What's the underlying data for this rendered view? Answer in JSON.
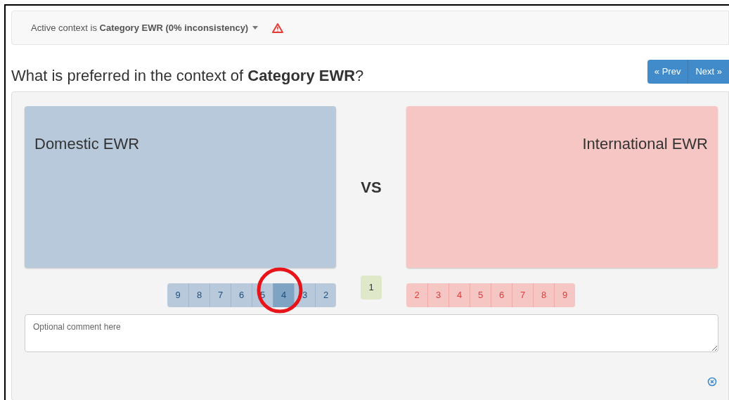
{
  "context_bar": {
    "text": "Active context is **Category EWR (0% inconsistency)**",
    "warning": true
  },
  "question": "What is preferred in the context of **Category EWR**?",
  "pager": [
    "« Prev",
    "Next »"
  ],
  "left_option": {
    "label": "Domestic EWR"
  },
  "separator": "VS",
  "right_option": {
    "label": "International EWR"
  },
  "left_scale": [
    {
      "label": "9",
      "selected": false
    },
    {
      "label": "8",
      "selected": false
    },
    {
      "label": "7",
      "selected": false
    },
    {
      "label": "6",
      "selected": false
    },
    {
      "label": "5",
      "selected": false
    },
    {
      "label": "4",
      "selected": true
    },
    {
      "label": "3",
      "selected": false
    },
    {
      "label": "2",
      "selected": false
    }
  ],
  "equal": {
    "label": "1",
    "selected": false
  },
  "right_scale": [
    {
      "label": "2",
      "selected": false
    },
    {
      "label": "3",
      "selected": false
    },
    {
      "label": "4",
      "selected": false
    },
    {
      "label": "5",
      "selected": false
    },
    {
      "label": "6",
      "selected": false
    },
    {
      "label": "7",
      "selected": false
    },
    {
      "label": "8",
      "selected": false
    },
    {
      "label": "9",
      "selected": false
    }
  ],
  "comment": {
    "placeholder": "Optional comment here"
  }
}
